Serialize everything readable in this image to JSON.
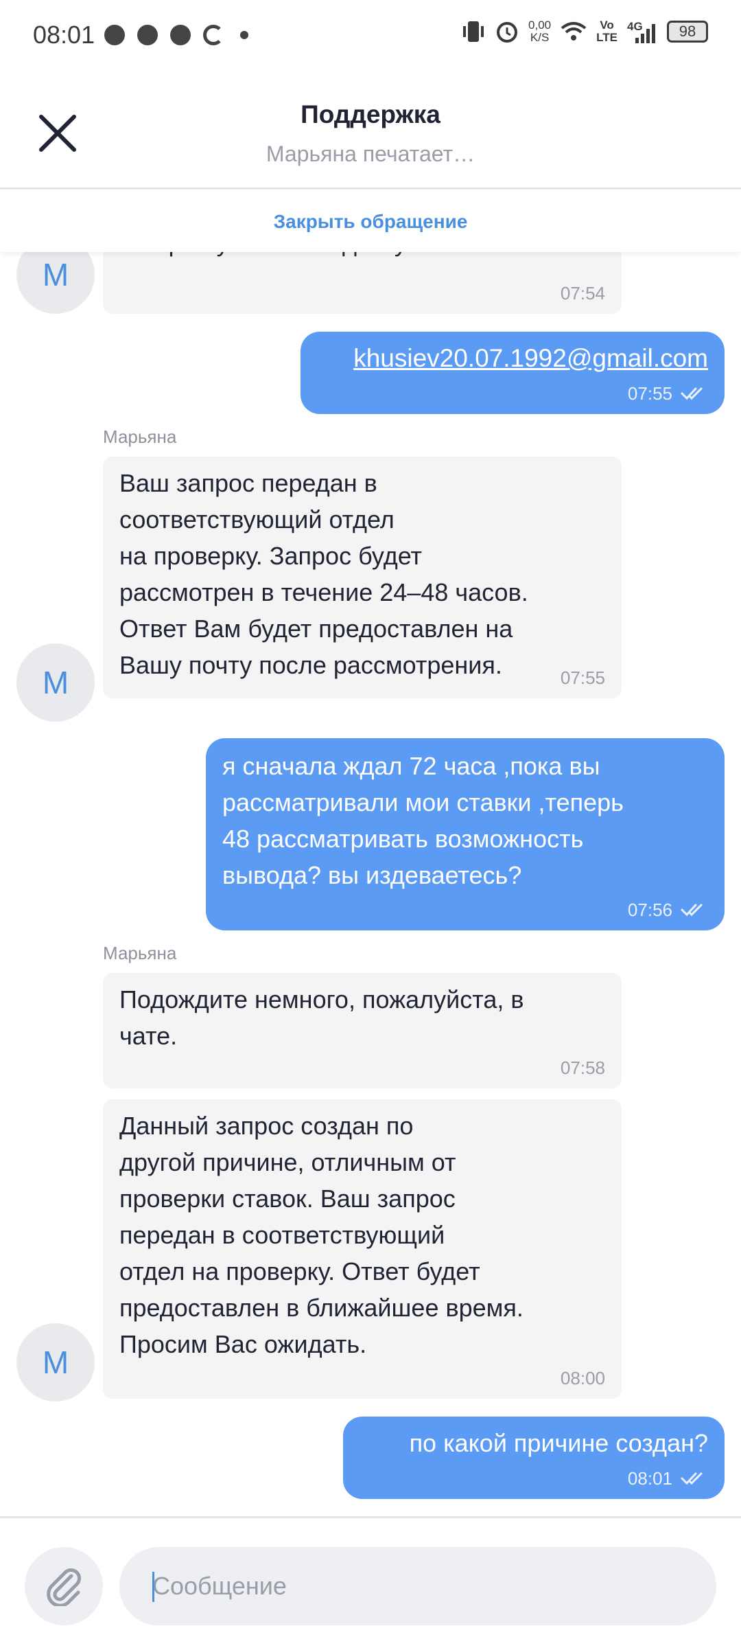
{
  "status_bar": {
    "time": "08:01",
    "net_speed_top": "0,00",
    "net_speed_bottom": "K/S",
    "volte_top": "Vo",
    "volte_bottom": "LTE",
    "network": "4G",
    "battery": "98"
  },
  "header": {
    "title": "Поддержка",
    "subtitle": "Марьяна печатает…",
    "close_ticket": "Закрыть обращение"
  },
  "messages": [
    {
      "text": "которой у Вас есть доступ.",
      "time": "07:54",
      "avatar": "М"
    },
    {
      "text": "khusiev20.07.1992@gmail.com",
      "time": "07:55"
    },
    {
      "sender": "Марьяна",
      "text": "Ваш запрос передан в\nсоответствующий отдел\nна проверку. Запрос будет\nрассмотрен в течение 24–48 часов.\nОтвет Вам будет предоставлен на\nВашу почту после рассмотрения.",
      "time": "07:55",
      "avatar": "М"
    },
    {
      "text": "я сначала ждал 72 часа ,пока вы\nрассматривали мои ставки ,теперь\n48 рассматривать возможность\nвывода? вы издеваетесь?",
      "time": "07:56"
    },
    {
      "sender": "Марьяна",
      "text": "Подождите немного, пожалуйста, в\nчате.",
      "time": "07:58"
    },
    {
      "text": "Данный запрос создан по\nдругой причине, отличным от\nпроверки ставок. Ваш запрос\nпередан в соответствующий\nотдел на проверку. Ответ будет\nпредоставлен в ближайшее время.\nПросим Вас ожидать.",
      "time": "08:00",
      "avatar": "М"
    },
    {
      "text": "по какой причине создан?",
      "time": "08:01"
    }
  ],
  "input": {
    "placeholder": "Сообщение"
  },
  "colors": {
    "accent": "#4a8fdd",
    "outgoing_bubble": "#5b9bf3",
    "incoming_bubble": "#f4f4f5"
  },
  "icons": {
    "close": "close-icon",
    "attach": "paperclip-icon",
    "read_receipt": "double-check-icon"
  }
}
